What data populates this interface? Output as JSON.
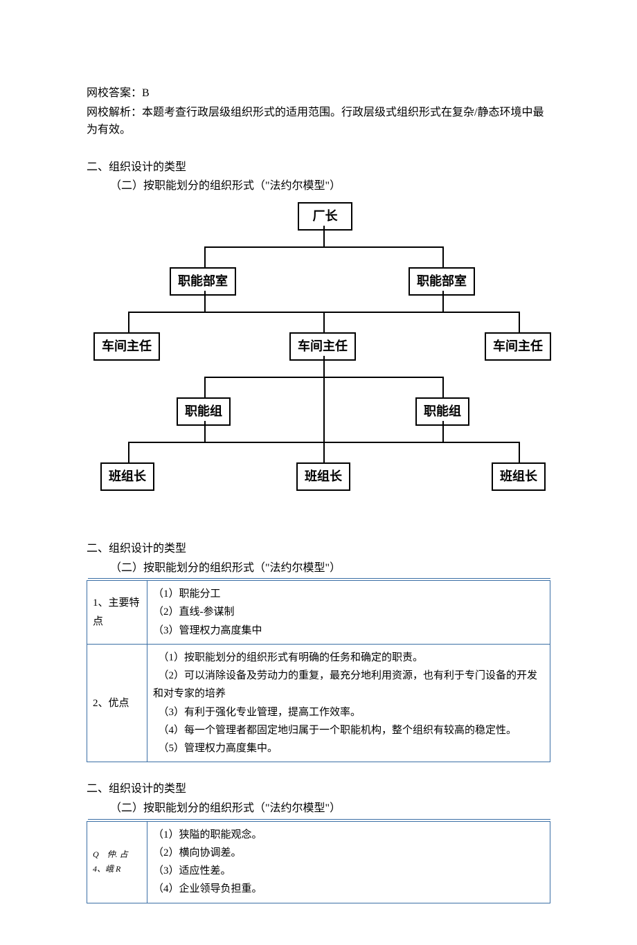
{
  "answer_line": "网校答案：B",
  "analysis_line": "网校解析：本题考查行政层级组织形式的适用范围。行政层级式组织形式在复杂/静态环境中最为有效。",
  "section_title": "二、组织设计的类型",
  "subsection_title": "（二）按职能划分的组织形式（\"法约尔模型\"）",
  "chart": {
    "l1": "厂长",
    "l2a": "职能部室",
    "l2b": "职能部室",
    "l3a": "车间主任",
    "l3b": "车间主任",
    "l3c": "车间主任",
    "l4a": "职能组",
    "l4b": "职能组",
    "l5a": "班组长",
    "l5b": "班组长",
    "l5c": "班组长"
  },
  "table1": {
    "r1_label": "1、主要特点",
    "r1_c1": "（1）职能分工",
    "r1_c2": "（2）直线-参谋制",
    "r1_c3": "（3）管理权力高度集中",
    "r2_label": "2、优点",
    "r2_c1": "　（1）按职能划分的组织形式有明确的任务和确定的职责。",
    "r2_c2": "　（2）可以消除设备及劳动力的重复，最充分地利用资源，也有利于专门设备的开发和对专家的培养",
    "r2_c3": "　（3）有利于强化专业管理，提高工作效率。",
    "r2_c4": "　（4）每一个管理者都固定地归属于一个职能机构，整个组织有较高的稳定性。",
    "r2_c5": "　（5）管理权力高度集中。"
  },
  "table2": {
    "r_label_a": "Q　仲. 占",
    "r_label_b": "4、峨 R",
    "c1": "（1）狭隘的职能观念。",
    "c2": "（2）横向协调差。",
    "c3": "（3）适应性差。",
    "c4": "（4）企业领导负担重。"
  }
}
